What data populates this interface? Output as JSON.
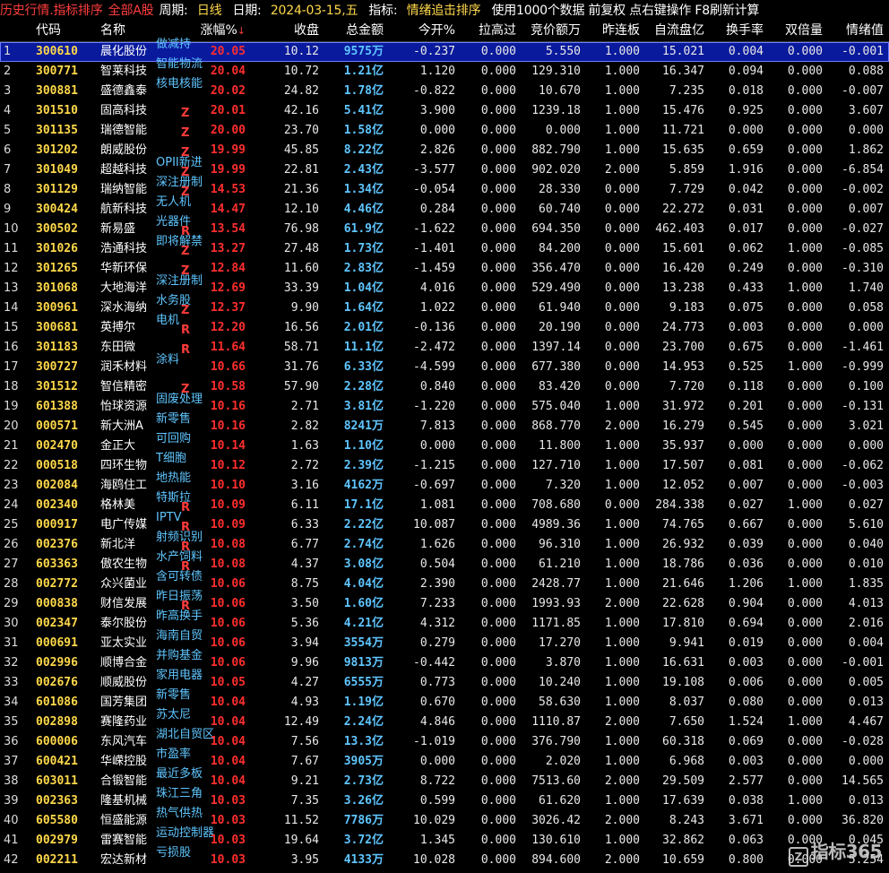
{
  "topbar": {
    "title": "历史行情.指标排序",
    "scope": "全部A股",
    "period_label": "周期:",
    "period_value": "日线",
    "date_label": "日期:",
    "date_value": "2024-03-15,五",
    "indicator_label": "指标:",
    "indicator_value": "情绪追击排序",
    "hint": "使用1000个数据 前复权 点右键操作 F8刷新计算"
  },
  "columns": {
    "code": "代码",
    "name": "名称",
    "pct": "涨幅%",
    "sort_arrow": "↓",
    "close": "收盘",
    "amount": "总金额",
    "open": "今开%",
    "pull": "拉高过",
    "bid": "竞价额万",
    "board": "昨连板",
    "float": "自流盘亿",
    "turnover": "换手率",
    "double": "双倍量",
    "emotion": "情绪值"
  },
  "rows": [
    {
      "idx": "1",
      "code": "300610",
      "name": "晨化股份",
      "tag": "做减持",
      "mark": "",
      "pct": "20.05",
      "close": "10.12",
      "amount": "9575万",
      "open": "-0.237",
      "pull": "0.000",
      "bid": "5.550",
      "board": "1.000",
      "float": "15.021",
      "turnover": "0.004",
      "double": "0.000",
      "emotion": "-0.001"
    },
    {
      "idx": "2",
      "code": "300771",
      "name": "智莱科技",
      "tag": "智能物流",
      "mark": "",
      "pct": "20.04",
      "close": "10.72",
      "amount": "1.21亿",
      "open": "1.120",
      "pull": "0.000",
      "bid": "129.310",
      "board": "1.000",
      "float": "16.347",
      "turnover": "0.094",
      "double": "0.000",
      "emotion": "0.088"
    },
    {
      "idx": "3",
      "code": "300881",
      "name": "盛德鑫泰",
      "tag": "核电核能",
      "mark": "",
      "pct": "20.02",
      "close": "24.82",
      "amount": "1.78亿",
      "open": "-0.822",
      "pull": "0.000",
      "bid": "10.670",
      "board": "1.000",
      "float": "7.235",
      "turnover": "0.018",
      "double": "0.000",
      "emotion": "-0.007"
    },
    {
      "idx": "4",
      "code": "301510",
      "name": "固高科技",
      "tag": "",
      "mark": "Z",
      "pct": "20.01",
      "close": "42.16",
      "amount": "5.41亿",
      "open": "3.900",
      "pull": "0.000",
      "bid": "1239.18",
      "board": "1.000",
      "float": "15.476",
      "turnover": "0.925",
      "double": "0.000",
      "emotion": "3.607"
    },
    {
      "idx": "5",
      "code": "301135",
      "name": "瑞德智能",
      "tag": "",
      "mark": "Z",
      "pct": "20.00",
      "close": "23.70",
      "amount": "1.58亿",
      "open": "0.000",
      "pull": "0.000",
      "bid": "0.000",
      "board": "1.000",
      "float": "11.721",
      "turnover": "0.000",
      "double": "0.000",
      "emotion": "0.000"
    },
    {
      "idx": "6",
      "code": "301202",
      "name": "朗威股份",
      "tag": "",
      "mark": "Z",
      "pct": "19.99",
      "close": "45.85",
      "amount": "8.22亿",
      "open": "2.826",
      "pull": "0.000",
      "bid": "882.790",
      "board": "1.000",
      "float": "15.635",
      "turnover": "0.659",
      "double": "0.000",
      "emotion": "1.862"
    },
    {
      "idx": "7",
      "code": "301049",
      "name": "超越科技",
      "tag": "OPII新进",
      "mark": "Z",
      "pct": "19.99",
      "close": "22.81",
      "amount": "2.43亿",
      "open": "-3.577",
      "pull": "0.000",
      "bid": "902.020",
      "board": "2.000",
      "float": "5.859",
      "turnover": "1.916",
      "double": "0.000",
      "emotion": "-6.854"
    },
    {
      "idx": "8",
      "code": "301129",
      "name": "瑞纳智能",
      "tag": "深注册制",
      "mark": "Z",
      "pct": "14.53",
      "close": "21.36",
      "amount": "1.34亿",
      "open": "-0.054",
      "pull": "0.000",
      "bid": "28.330",
      "board": "0.000",
      "float": "7.729",
      "turnover": "0.042",
      "double": "0.000",
      "emotion": "-0.002"
    },
    {
      "idx": "9",
      "code": "300424",
      "name": "航新科技",
      "tag": "无人机",
      "mark": "",
      "pct": "14.47",
      "close": "12.10",
      "amount": "4.46亿",
      "open": "0.284",
      "pull": "0.000",
      "bid": "60.740",
      "board": "0.000",
      "float": "22.272",
      "turnover": "0.031",
      "double": "0.000",
      "emotion": "0.007"
    },
    {
      "idx": "10",
      "code": "300502",
      "name": "新易盛",
      "tag": "光器件",
      "mark": "R",
      "pct": "13.54",
      "close": "76.98",
      "amount": "61.9亿",
      "open": "-1.622",
      "pull": "0.000",
      "bid": "694.350",
      "board": "0.000",
      "float": "462.403",
      "turnover": "0.017",
      "double": "0.000",
      "emotion": "-0.027"
    },
    {
      "idx": "11",
      "code": "301026",
      "name": "浩通科技",
      "tag": "即将解禁",
      "mark": "Z",
      "pct": "13.27",
      "close": "27.48",
      "amount": "1.73亿",
      "open": "-1.401",
      "pull": "0.000",
      "bid": "84.200",
      "board": "0.000",
      "float": "15.601",
      "turnover": "0.062",
      "double": "1.000",
      "emotion": "-0.085"
    },
    {
      "idx": "12",
      "code": "301265",
      "name": "华新环保",
      "tag": "",
      "mark": "Z",
      "pct": "12.84",
      "close": "11.60",
      "amount": "2.83亿",
      "open": "-1.459",
      "pull": "0.000",
      "bid": "356.470",
      "board": "0.000",
      "float": "16.420",
      "turnover": "0.249",
      "double": "0.000",
      "emotion": "-0.310"
    },
    {
      "idx": "13",
      "code": "301068",
      "name": "大地海洋",
      "tag": "深注册制",
      "mark": "",
      "pct": "12.69",
      "close": "33.39",
      "amount": "1.04亿",
      "open": "4.016",
      "pull": "0.000",
      "bid": "529.490",
      "board": "0.000",
      "float": "13.238",
      "turnover": "0.433",
      "double": "1.000",
      "emotion": "1.740"
    },
    {
      "idx": "14",
      "code": "300961",
      "name": "深水海纳",
      "tag": "水务股",
      "mark": "Z",
      "pct": "12.37",
      "close": "9.90",
      "amount": "1.64亿",
      "open": "1.022",
      "pull": "0.000",
      "bid": "61.940",
      "board": "0.000",
      "float": "9.183",
      "turnover": "0.075",
      "double": "0.000",
      "emotion": "0.058"
    },
    {
      "idx": "15",
      "code": "300681",
      "name": "英搏尔",
      "tag": "电机",
      "mark": "R",
      "pct": "12.20",
      "close": "16.56",
      "amount": "2.01亿",
      "open": "-0.136",
      "pull": "0.000",
      "bid": "20.190",
      "board": "0.000",
      "float": "24.773",
      "turnover": "0.003",
      "double": "0.000",
      "emotion": "0.000"
    },
    {
      "idx": "16",
      "code": "301183",
      "name": "东田微",
      "tag": "",
      "mark": "R",
      "pct": "11.64",
      "close": "58.71",
      "amount": "11.1亿",
      "open": "-2.472",
      "pull": "0.000",
      "bid": "1397.14",
      "board": "0.000",
      "float": "23.700",
      "turnover": "0.675",
      "double": "0.000",
      "emotion": "-1.461"
    },
    {
      "idx": "17",
      "code": "300727",
      "name": "润禾材料",
      "tag": "涂料",
      "mark": "",
      "pct": "10.66",
      "close": "31.76",
      "amount": "6.33亿",
      "open": "-4.599",
      "pull": "0.000",
      "bid": "677.380",
      "board": "0.000",
      "float": "14.953",
      "turnover": "0.525",
      "double": "1.000",
      "emotion": "-0.999"
    },
    {
      "idx": "18",
      "code": "301512",
      "name": "智信精密",
      "tag": "",
      "mark": "Z",
      "pct": "10.58",
      "close": "57.90",
      "amount": "2.28亿",
      "open": "0.840",
      "pull": "0.000",
      "bid": "83.420",
      "board": "0.000",
      "float": "7.720",
      "turnover": "0.118",
      "double": "0.000",
      "emotion": "0.100"
    },
    {
      "idx": "19",
      "code": "601388",
      "name": "怡球资源",
      "tag": "固废处理",
      "mark": "",
      "pct": "10.16",
      "close": "2.71",
      "amount": "3.81亿",
      "open": "-1.220",
      "pull": "0.000",
      "bid": "575.040",
      "board": "1.000",
      "float": "31.972",
      "turnover": "0.201",
      "double": "0.000",
      "emotion": "-0.131"
    },
    {
      "idx": "20",
      "code": "000571",
      "name": "新大洲A",
      "tag": "新零售",
      "mark": "",
      "pct": "10.16",
      "close": "2.82",
      "amount": "8241万",
      "open": "7.813",
      "pull": "0.000",
      "bid": "868.770",
      "board": "2.000",
      "float": "16.279",
      "turnover": "0.545",
      "double": "0.000",
      "emotion": "3.021"
    },
    {
      "idx": "21",
      "code": "002470",
      "name": "金正大",
      "tag": "可回购",
      "mark": "",
      "pct": "10.14",
      "close": "1.63",
      "amount": "1.10亿",
      "open": "0.000",
      "pull": "0.000",
      "bid": "11.800",
      "board": "1.000",
      "float": "35.937",
      "turnover": "0.000",
      "double": "0.000",
      "emotion": "0.000"
    },
    {
      "idx": "22",
      "code": "000518",
      "name": "四环生物",
      "tag": "T细胞",
      "mark": "",
      "pct": "10.12",
      "close": "2.72",
      "amount": "2.39亿",
      "open": "-1.215",
      "pull": "0.000",
      "bid": "127.710",
      "board": "1.000",
      "float": "17.507",
      "turnover": "0.081",
      "double": "0.000",
      "emotion": "-0.062"
    },
    {
      "idx": "23",
      "code": "002084",
      "name": "海鸥住工",
      "tag": "地热能",
      "mark": "",
      "pct": "10.10",
      "close": "3.16",
      "amount": "4162万",
      "open": "-0.697",
      "pull": "0.000",
      "bid": "7.320",
      "board": "1.000",
      "float": "12.052",
      "turnover": "0.007",
      "double": "0.000",
      "emotion": "-0.003"
    },
    {
      "idx": "24",
      "code": "002340",
      "name": "格林美",
      "tag": "特斯拉",
      "mark": "R",
      "pct": "10.09",
      "close": "6.11",
      "amount": "17.1亿",
      "open": "1.081",
      "pull": "0.000",
      "bid": "708.680",
      "board": "0.000",
      "float": "284.338",
      "turnover": "0.027",
      "double": "1.000",
      "emotion": "0.027"
    },
    {
      "idx": "25",
      "code": "000917",
      "name": "电广传媒",
      "tag": "IPTV",
      "mark": "R",
      "pct": "10.09",
      "close": "6.33",
      "amount": "2.22亿",
      "open": "10.087",
      "pull": "0.000",
      "bid": "4989.36",
      "board": "1.000",
      "float": "74.765",
      "turnover": "0.667",
      "double": "0.000",
      "emotion": "5.610"
    },
    {
      "idx": "26",
      "code": "002376",
      "name": "新北洋",
      "tag": "射频识别",
      "mark": "R",
      "pct": "10.08",
      "close": "6.77",
      "amount": "2.74亿",
      "open": "1.626",
      "pull": "0.000",
      "bid": "96.310",
      "board": "1.000",
      "float": "26.932",
      "turnover": "0.039",
      "double": "0.000",
      "emotion": "0.040"
    },
    {
      "idx": "27",
      "code": "603363",
      "name": "傲农生物",
      "tag": "水产饲料",
      "mark": "R",
      "pct": "10.08",
      "close": "4.37",
      "amount": "3.08亿",
      "open": "0.504",
      "pull": "0.000",
      "bid": "61.210",
      "board": "1.000",
      "float": "18.786",
      "turnover": "0.036",
      "double": "0.000",
      "emotion": "0.010"
    },
    {
      "idx": "28",
      "code": "002772",
      "name": "众兴菌业",
      "tag": "含可转债",
      "mark": "",
      "pct": "10.06",
      "close": "8.75",
      "amount": "4.04亿",
      "open": "2.390",
      "pull": "0.000",
      "bid": "2428.77",
      "board": "1.000",
      "float": "21.646",
      "turnover": "1.206",
      "double": "1.000",
      "emotion": "1.835"
    },
    {
      "idx": "29",
      "code": "000838",
      "name": "财信发展",
      "tag": "昨日振荡",
      "mark": "R",
      "pct": "10.06",
      "close": "3.50",
      "amount": "1.60亿",
      "open": "7.233",
      "pull": "0.000",
      "bid": "1993.93",
      "board": "2.000",
      "float": "22.628",
      "turnover": "0.904",
      "double": "0.000",
      "emotion": "4.013"
    },
    {
      "idx": "30",
      "code": "002347",
      "name": "泰尔股份",
      "tag": "昨高换手",
      "mark": "",
      "pct": "10.06",
      "close": "5.36",
      "amount": "4.21亿",
      "open": "4.312",
      "pull": "0.000",
      "bid": "1171.85",
      "board": "1.000",
      "float": "17.810",
      "turnover": "0.694",
      "double": "0.000",
      "emotion": "2.016"
    },
    {
      "idx": "31",
      "code": "000691",
      "name": "亚太实业",
      "tag": "海南自贸",
      "mark": "",
      "pct": "10.06",
      "close": "3.94",
      "amount": "3554万",
      "open": "0.279",
      "pull": "0.000",
      "bid": "17.270",
      "board": "1.000",
      "float": "9.941",
      "turnover": "0.019",
      "double": "0.000",
      "emotion": "0.004"
    },
    {
      "idx": "32",
      "code": "002996",
      "name": "顺博合金",
      "tag": "并购基金",
      "mark": "",
      "pct": "10.06",
      "close": "9.96",
      "amount": "9813万",
      "open": "-0.442",
      "pull": "0.000",
      "bid": "3.870",
      "board": "1.000",
      "float": "16.631",
      "turnover": "0.003",
      "double": "0.000",
      "emotion": "-0.001"
    },
    {
      "idx": "33",
      "code": "002676",
      "name": "顺威股份",
      "tag": "家用电器",
      "mark": "",
      "pct": "10.05",
      "close": "4.27",
      "amount": "6555万",
      "open": "0.773",
      "pull": "0.000",
      "bid": "10.240",
      "board": "1.000",
      "float": "19.108",
      "turnover": "0.006",
      "double": "0.000",
      "emotion": "0.005"
    },
    {
      "idx": "34",
      "code": "601086",
      "name": "国芳集团",
      "tag": "新零售",
      "mark": "",
      "pct": "10.04",
      "close": "4.93",
      "amount": "1.19亿",
      "open": "0.670",
      "pull": "0.000",
      "bid": "58.630",
      "board": "1.000",
      "float": "8.037",
      "turnover": "0.080",
      "double": "0.000",
      "emotion": "0.013"
    },
    {
      "idx": "35",
      "code": "002898",
      "name": "赛隆药业",
      "tag": "苏太尼",
      "mark": "",
      "pct": "10.04",
      "close": "12.49",
      "amount": "2.24亿",
      "open": "4.846",
      "pull": "0.000",
      "bid": "1110.87",
      "board": "2.000",
      "float": "7.650",
      "turnover": "1.524",
      "double": "1.000",
      "emotion": "4.467"
    },
    {
      "idx": "36",
      "code": "600006",
      "name": "东风汽车",
      "tag": "湖北自贸区",
      "mark": "",
      "pct": "10.04",
      "close": "7.56",
      "amount": "13.3亿",
      "open": "-1.019",
      "pull": "0.000",
      "bid": "376.790",
      "board": "1.000",
      "float": "60.318",
      "turnover": "0.069",
      "double": "0.000",
      "emotion": "-0.028"
    },
    {
      "idx": "37",
      "code": "600421",
      "name": "华嵘控股",
      "tag": "市盈率",
      "mark": "",
      "pct": "10.04",
      "close": "7.67",
      "amount": "3905万",
      "open": "0.000",
      "pull": "0.000",
      "bid": "2.020",
      "board": "1.000",
      "float": "6.968",
      "turnover": "0.003",
      "double": "0.000",
      "emotion": "0.000"
    },
    {
      "idx": "38",
      "code": "603011",
      "name": "合锻智能",
      "tag": "最近多板",
      "mark": "",
      "pct": "10.04",
      "close": "9.21",
      "amount": "2.73亿",
      "open": "8.722",
      "pull": "0.000",
      "bid": "7513.60",
      "board": "2.000",
      "float": "29.509",
      "turnover": "2.577",
      "double": "0.000",
      "emotion": "14.565"
    },
    {
      "idx": "39",
      "code": "002363",
      "name": "隆基机械",
      "tag": "珠江三角",
      "mark": "",
      "pct": "10.03",
      "close": "7.35",
      "amount": "3.26亿",
      "open": "0.599",
      "pull": "0.000",
      "bid": "61.620",
      "board": "1.000",
      "float": "17.639",
      "turnover": "0.038",
      "double": "1.000",
      "emotion": "0.013"
    },
    {
      "idx": "40",
      "code": "605580",
      "name": "恒盛能源",
      "tag": "热气供热",
      "mark": "",
      "pct": "10.03",
      "close": "11.52",
      "amount": "7786万",
      "open": "10.029",
      "pull": "0.000",
      "bid": "3026.42",
      "board": "2.000",
      "float": "8.243",
      "turnover": "3.671",
      "double": "0.000",
      "emotion": "36.820"
    },
    {
      "idx": "41",
      "code": "002979",
      "name": "雷赛智能",
      "tag": "运动控制器",
      "mark": "",
      "pct": "10.03",
      "close": "19.64",
      "amount": "3.72亿",
      "open": "1.345",
      "pull": "0.000",
      "bid": "130.610",
      "board": "1.000",
      "float": "32.862",
      "turnover": "0.063",
      "double": "0.000",
      "emotion": "0.045"
    },
    {
      "idx": "42",
      "code": "002211",
      "name": "宏达新材",
      "tag": "亏损股",
      "mark": "",
      "pct": "10.03",
      "close": "3.95",
      "amount": "4133万",
      "open": "10.028",
      "pull": "0.000",
      "bid": "894.600",
      "board": "2.000",
      "float": "10.659",
      "turnover": "0.800",
      "double": "0.000",
      "emotion": "5.254"
    }
  ],
  "watermark": {
    "icon": "Z",
    "text": "指标365"
  }
}
